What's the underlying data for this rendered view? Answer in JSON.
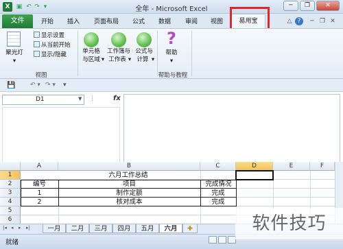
{
  "window": {
    "title": "全年 - Microsoft Excel",
    "app_icon": "X",
    "quick_access": [
      "save-icon",
      "undo-icon",
      "redo-icon",
      "customize-icon"
    ],
    "controls": {
      "minimize": "─",
      "restore": "❐",
      "close": "✕"
    }
  },
  "tabs": {
    "file": "文件",
    "items": [
      "开始",
      "插入",
      "页面布局",
      "公式",
      "数据",
      "审阅",
      "视图"
    ],
    "active": "易用宝",
    "right_icons": [
      "△",
      "?",
      "─",
      "❐",
      "✕"
    ]
  },
  "ribbon": {
    "spotlight_label": "聚光灯",
    "spotlight_arrow": "▾",
    "show_settings": "显示设置",
    "from_current": "从当前开始",
    "show_hide": "显示/隐藏",
    "group_view": "视图",
    "cell_region_1": "单元格",
    "cell_region_2": "与区域",
    "workbook_1": "工作簿与",
    "workbook_2": "工作表",
    "formula_1": "公式与",
    "formula_2": "计算",
    "help_label": "帮助",
    "help_group": "帮助与教程",
    "help_icon": "?",
    "dropdown": "▾"
  },
  "qat": {
    "save": "💾",
    "undo": "↶ ▾",
    "redo": "↷ ▾",
    "more": "▾"
  },
  "formula_bar": {
    "name_box": "D1",
    "fx": "fx"
  },
  "columns": [
    "A",
    "B",
    "C",
    "D",
    "E",
    "F"
  ],
  "rows": [
    "1",
    "2",
    "3",
    "4",
    "5",
    "6"
  ],
  "cells": {
    "b1": "六月工作总结",
    "a2": "编号",
    "b2": "项目",
    "c2": "完成情况",
    "a3": "1",
    "b3": "制作定额",
    "c3": "完成",
    "a4": "2",
    "b4": "核对成本",
    "c4": "完成"
  },
  "sheets": [
    "一月",
    "二月",
    "三月",
    "四月",
    "五月",
    "六月"
  ],
  "active_sheet": "六月",
  "sheet_nav": [
    "|◂",
    "◂",
    "▸",
    "▸|"
  ],
  "status": {
    "text": "就绪"
  },
  "watermark": "软件技巧"
}
